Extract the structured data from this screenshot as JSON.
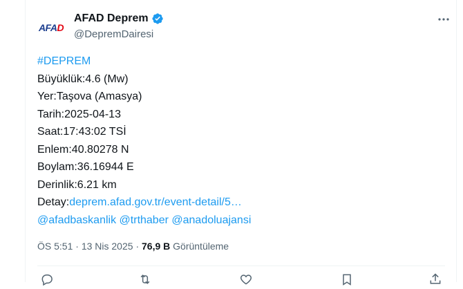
{
  "account": {
    "display_name": "AFAD Deprem",
    "handle": "@DepremDairesi",
    "avatar_text_main": "AFA",
    "avatar_text_accent": "D"
  },
  "tweet": {
    "hashtag": "#DEPREM",
    "lines": [
      "Büyüklük:4.6 (Mw)",
      "Yer:Taşova (Amasya)",
      "Tarih:2025-04-13",
      "Saat:17:43:02 TSİ",
      "Enlem:40.80278 N",
      "Boylam:36.16944 E",
      "Derinlik:6.21 km"
    ],
    "detail_label": "Detay:",
    "detail_link": "deprem.afad.gov.tr/event-detail/5…",
    "mentions": [
      "@afadbaskanlik",
      "@trthaber",
      "@anadoluajansi"
    ]
  },
  "meta": {
    "time": "ÖS 5:51",
    "dot": "·",
    "date": "13 Nis 2025",
    "views_count": "76,9 B",
    "views_label": "Görüntüleme"
  },
  "icons": {
    "verified": "verified-badge-icon",
    "more": "more-options-icon",
    "reply": "reply-icon",
    "retweet": "retweet-icon",
    "like": "like-icon",
    "bookmark": "bookmark-icon",
    "share": "share-icon"
  },
  "colors": {
    "link": "#1d9bf0",
    "text": "#0f1419",
    "muted": "#536471",
    "border": "#eff3f4",
    "logo_blue": "#1d3f8f",
    "logo_red": "#e30613"
  }
}
